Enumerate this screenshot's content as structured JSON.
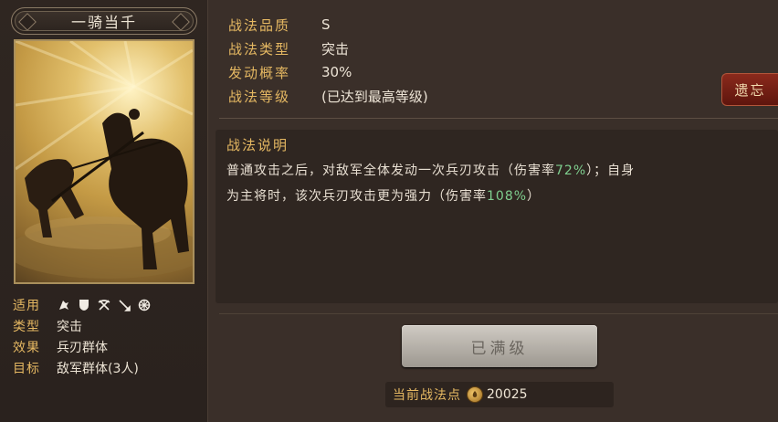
{
  "skill": {
    "name": "一骑当千"
  },
  "stats": [
    {
      "label": "战法品质",
      "value": "S"
    },
    {
      "label": "战法类型",
      "value": "突击"
    },
    {
      "label": "发动概率",
      "value": "30%"
    },
    {
      "label": "战法等级",
      "value": "(已达到最高等级)"
    }
  ],
  "forget_button": "遗忘",
  "description": {
    "title": "战法说明",
    "line1_pre": "普通攻击之后，对敌军全体发动一次兵刃攻击（伤害率",
    "line1_hl": "72%",
    "line1_post": "）；自身",
    "line2_pre": "为主将时，该次兵刃攻击更为强力（伤害率",
    "line2_hl": "108%",
    "line2_post": "）",
    "highlight_color": "#7fcf8f"
  },
  "attributes": {
    "suit_label": "适用",
    "suit_icons": [
      "cavalry-icon",
      "shield-icon",
      "bow-icon",
      "spear-icon",
      "ship-wheel-icon"
    ],
    "type_label": "类型",
    "type_value": "突击",
    "effect_label": "效果",
    "effect_value": "兵刃群体",
    "target_label": "目标",
    "target_value": "敌军群体(3人)"
  },
  "maxed_button": "已满级",
  "points": {
    "label": "当前战法点",
    "value": "20025"
  },
  "colors": {
    "accent_gold": "#e5b862",
    "forget_red": "#7a2116"
  }
}
